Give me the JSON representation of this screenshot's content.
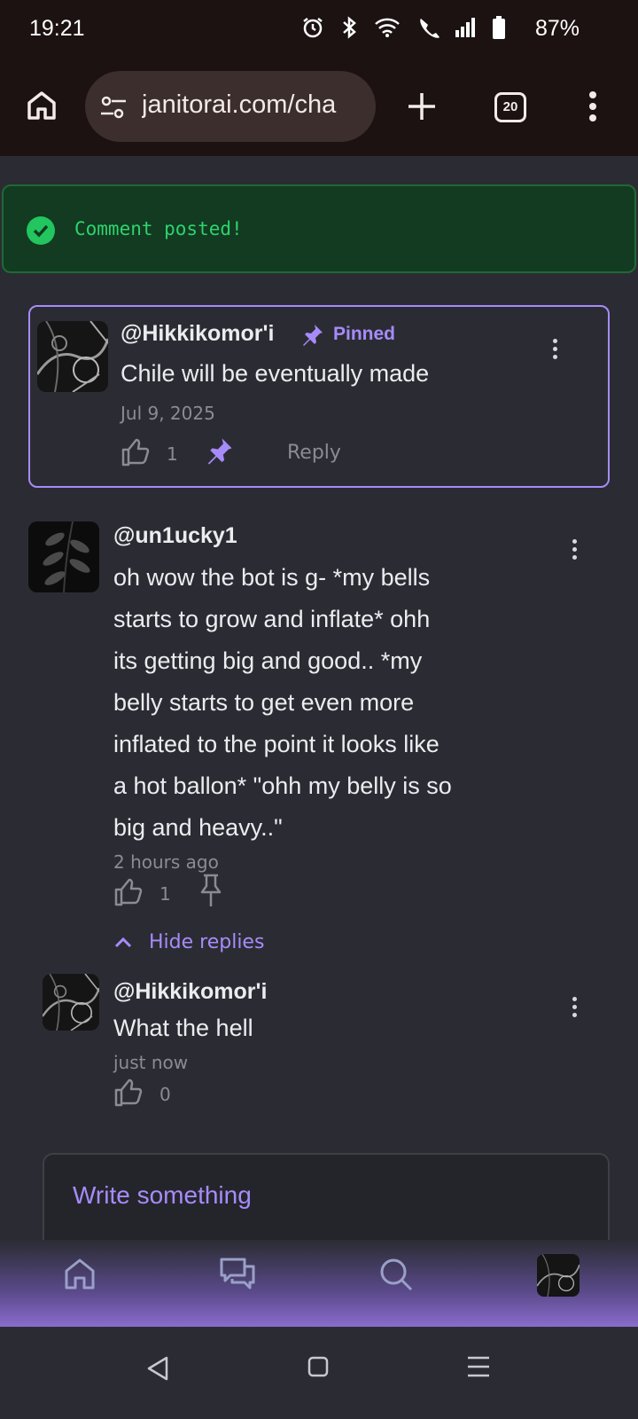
{
  "status": {
    "time": "19:21",
    "battery": "87%"
  },
  "browser": {
    "url": "janitorai.com/cha",
    "tab_count": "20"
  },
  "toast": {
    "message": "Comment posted!"
  },
  "pinned_comment": {
    "username": "@Hikkikomor'i",
    "pinned_label": "Pinned",
    "text": "Chile will be eventually made",
    "date": "Jul 9, 2025",
    "likes": "1",
    "reply_label": "Reply"
  },
  "comment": {
    "username": "@un1ucky1",
    "lines": [
      "oh wow the bot is g- *my bells",
      "starts to grow and inflate* ohh",
      "its getting big and good.. *my",
      "belly starts to get even more",
      "inflated to the point it looks like",
      "a hot ballon* \"ohh my belly is so",
      "big and heavy..\""
    ],
    "time": "2 hours ago",
    "likes": "1",
    "hide_replies_label": "Hide replies"
  },
  "reply": {
    "username": "@Hikkikomor'i",
    "text": "What the hell",
    "time": "just now",
    "likes": "0"
  },
  "input": {
    "placeholder": "Write something"
  },
  "colors": {
    "accent": "#a78bfa",
    "toast_text": "#2fd36c",
    "background": "#2b2c33"
  }
}
